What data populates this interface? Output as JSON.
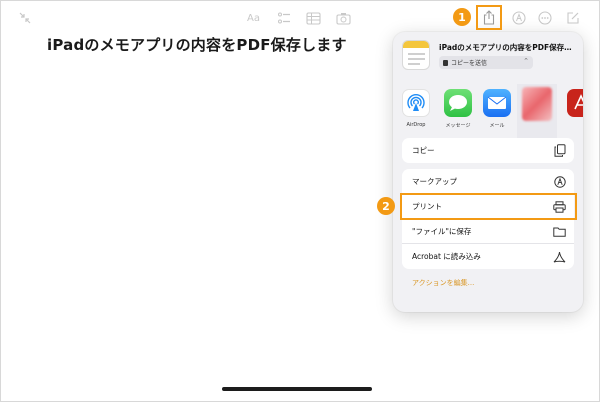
{
  "note": {
    "title": "iPadのメモアプリの内容をPDF保存します"
  },
  "toolbar": {
    "text_format_label": "Aa",
    "icons": [
      "collapse-icon",
      "text-format-icon",
      "checklist-icon",
      "table-icon",
      "camera-icon",
      "share-icon",
      "markup-icon",
      "more-icon",
      "compose-icon"
    ]
  },
  "share_sheet": {
    "title": "iPadのメモアプリの内容をPDF保存…",
    "mode_pill": "コピーを送信",
    "apps": [
      {
        "label": "AirDrop",
        "icon": "airdrop-icon"
      },
      {
        "label": "メッセージ",
        "icon": "messages-icon"
      },
      {
        "label": "メール",
        "icon": "mail-icon"
      },
      {
        "label": "",
        "icon": "blurred-contact-icon"
      },
      {
        "label": "",
        "icon": "acrobat-app-icon"
      }
    ],
    "actions": [
      {
        "label": "コピー",
        "icon": "copy-icon"
      },
      {
        "label": "マークアップ",
        "icon": "markup-icon"
      },
      {
        "label": "プリント",
        "icon": "print-icon"
      },
      {
        "label": "\"ファイル\"に保存",
        "icon": "folder-icon"
      },
      {
        "label": "Acrobat に読み込み",
        "icon": "acrobat-icon"
      }
    ],
    "edit_actions": "アクションを編集..."
  },
  "annotations": {
    "step1": "1",
    "step2": "2",
    "highlight_color": "#f39a14"
  }
}
